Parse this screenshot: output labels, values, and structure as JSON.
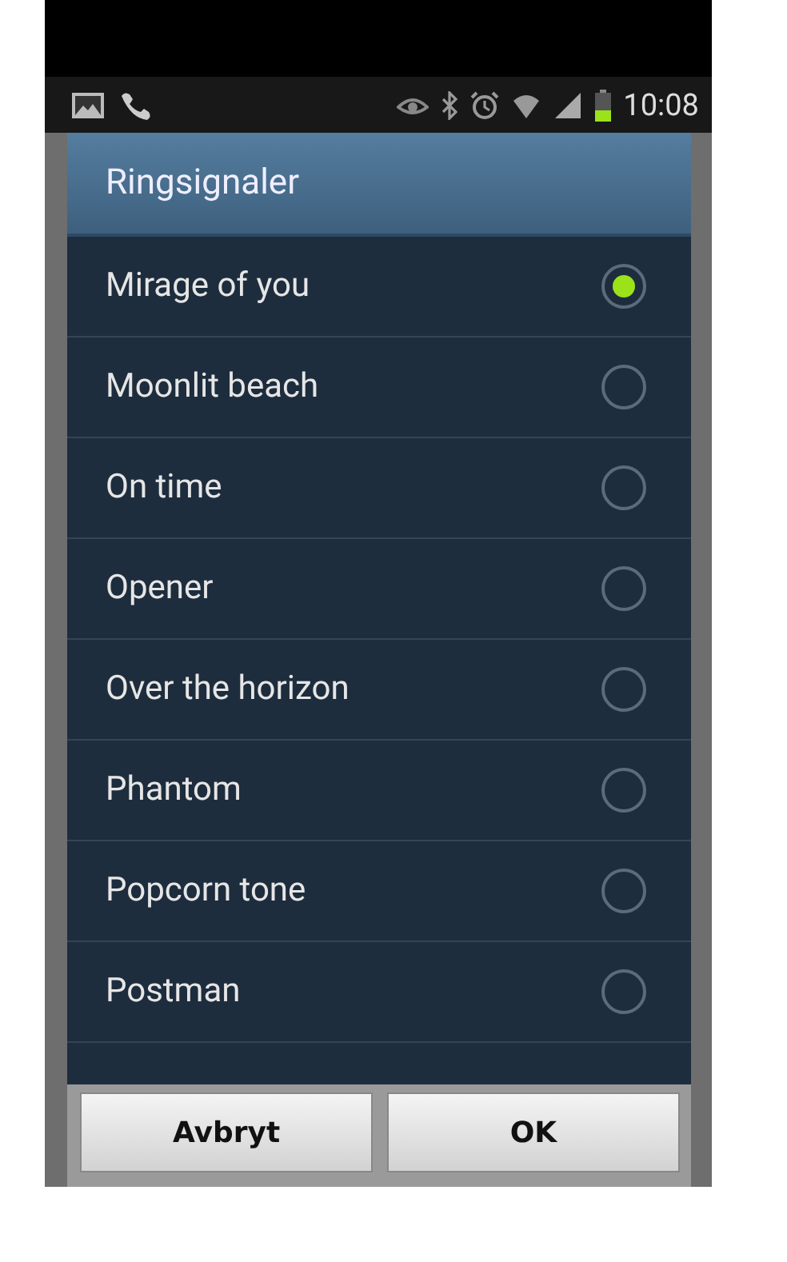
{
  "status_bar": {
    "time": "10:08"
  },
  "dialog": {
    "title": "Ringsignaler",
    "options": [
      {
        "label": "Mirage of you",
        "selected": true
      },
      {
        "label": "Moonlit beach",
        "selected": false
      },
      {
        "label": "On time",
        "selected": false
      },
      {
        "label": "Opener",
        "selected": false
      },
      {
        "label": "Over the horizon",
        "selected": false
      },
      {
        "label": "Phantom",
        "selected": false
      },
      {
        "label": "Popcorn tone",
        "selected": false
      },
      {
        "label": "Postman",
        "selected": false
      }
    ],
    "buttons": [
      {
        "label": "Avbryt"
      },
      {
        "label": "OK"
      }
    ]
  }
}
